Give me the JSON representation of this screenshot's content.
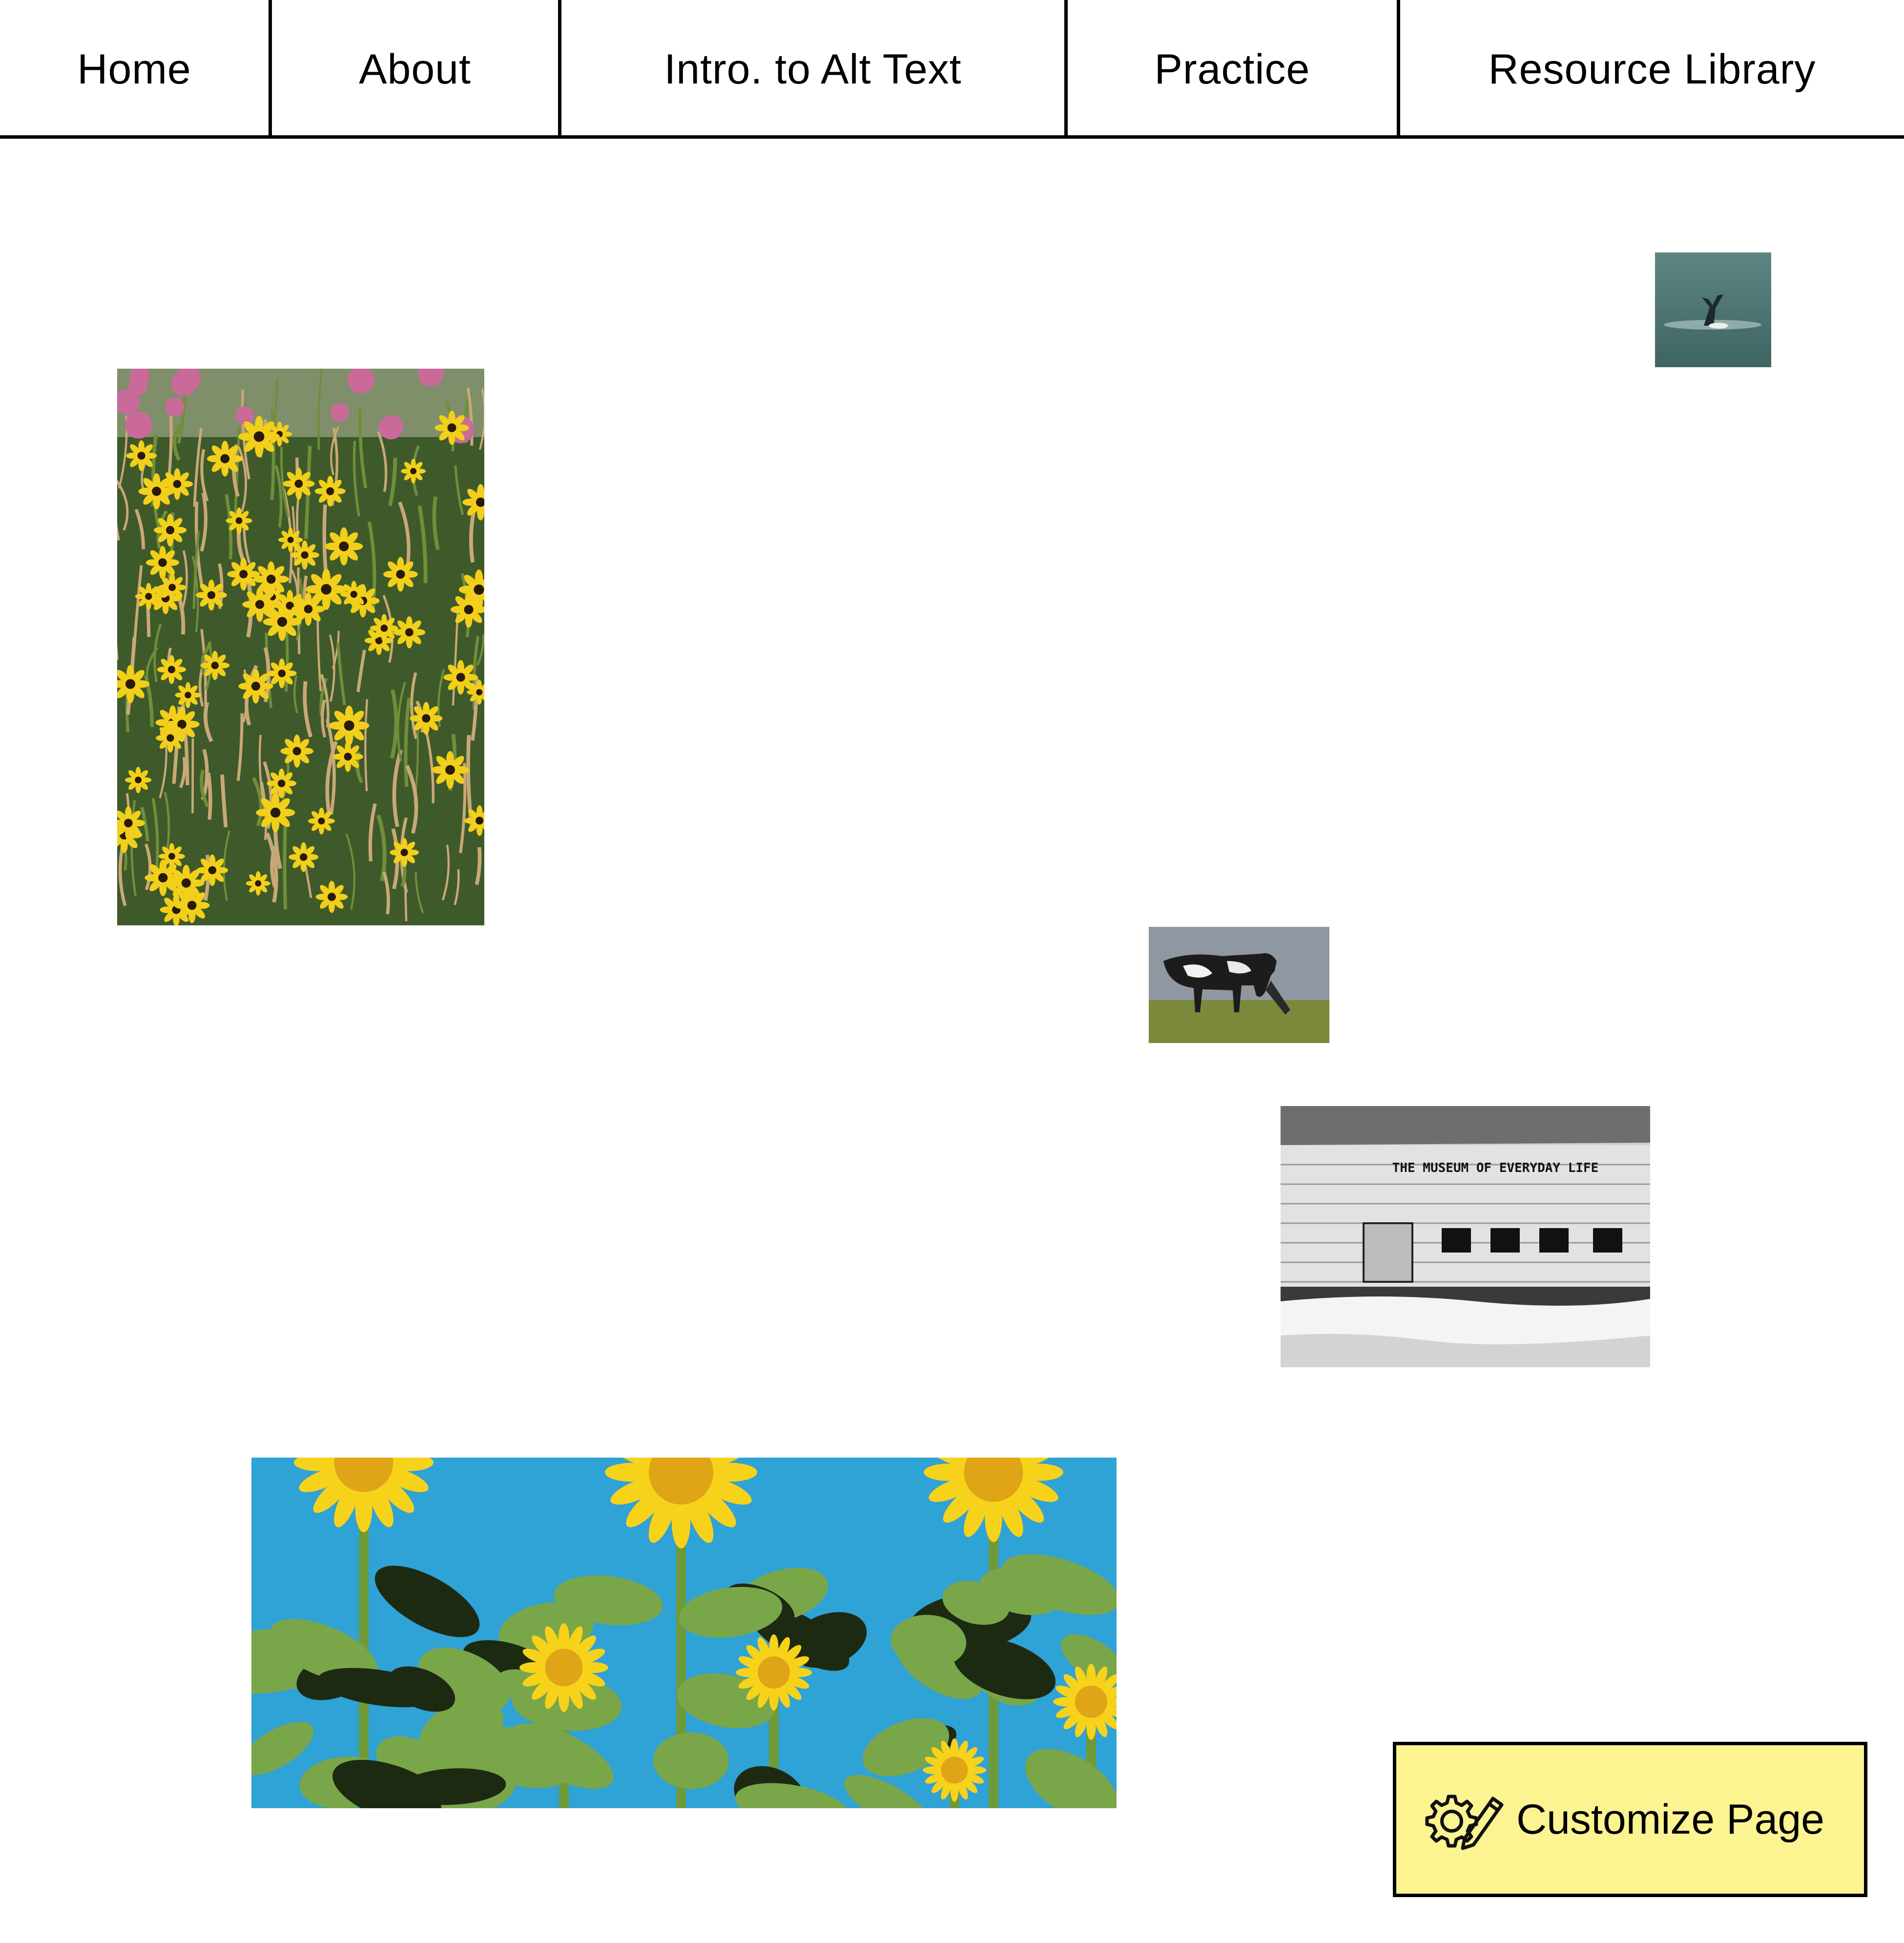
{
  "nav": {
    "items": [
      {
        "label": "Home"
      },
      {
        "label": "About"
      },
      {
        "label": "Intro. to Alt Text"
      },
      {
        "label": "Practice"
      },
      {
        "label": "Resource Library"
      }
    ]
  },
  "images": {
    "museum_sign": "THE MUSEUM OF EVERYDAY LIFE"
  },
  "customize": {
    "label": "Customize Page",
    "icon": "gear-pencil-icon",
    "background": "#fcf391"
  }
}
